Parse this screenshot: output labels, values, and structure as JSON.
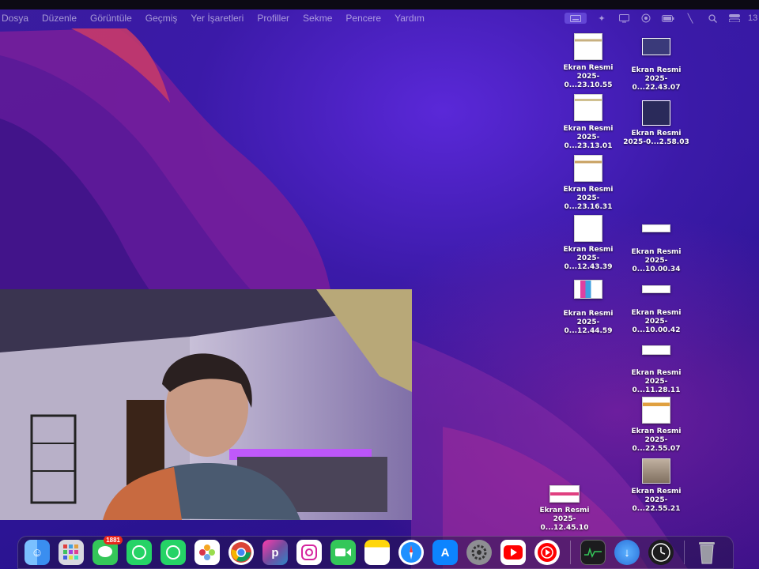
{
  "menubar": {
    "items": [
      "Dosya",
      "Düzenle",
      "Görüntüle",
      "Geçmiş",
      "Yer İşaretleri",
      "Profiller",
      "Sekme",
      "Pencere",
      "Yardım"
    ],
    "clock": "13"
  },
  "desktop": {
    "files": [
      {
        "line1": "Ekran Resmi",
        "line2": "2025-0...23.10.55"
      },
      {
        "line1": "Ekran Resmi",
        "line2": "2025-0...22.43.07"
      },
      {
        "line1": "Ekran Resmi",
        "line2": "2025-0...23.13.01"
      },
      {
        "line1": "Ekran Resmi",
        "line2": "2025-0...2.58.03"
      },
      {
        "line1": "Ekran Resmi",
        "line2": "2025-0...23.16.31"
      },
      {
        "line1": "Ekran Resmi",
        "line2": "2025-0...12.43.39"
      },
      {
        "line1": "Ekran Resmi",
        "line2": "2025-0...10.00.34"
      },
      {
        "line1": "Ekran Resmi",
        "line2": "2025-0...12.44.59"
      },
      {
        "line1": "Ekran Resmi",
        "line2": "2025-0...10.00.42"
      },
      {
        "line1": "Ekran Resmi",
        "line2": "2025-0...11.28.11"
      },
      {
        "line1": "Ekran Resmi",
        "line2": "2025-0...22.55.07"
      },
      {
        "line1": "Ekran Resmi",
        "line2": "2025-0...22.55.21"
      },
      {
        "line1": "Ekran Resmi",
        "line2": "2025-0...12.45.10"
      }
    ]
  },
  "dock": {
    "messages_badge": "1881",
    "apps": [
      "finder-icon",
      "launchpad-icon",
      "messages-icon",
      "whatsapp-icon",
      "whatsapp-business-icon",
      "photos-icon",
      "chrome-icon",
      "picsart-icon",
      "instagram-icon",
      "facetime-icon",
      "notes-icon",
      "safari-icon",
      "app-store-icon",
      "system-settings-icon",
      "youtube-icon",
      "youtube-music-icon",
      "activity-monitor-icon",
      "downloads-icon",
      "clock-icon",
      "trash-icon"
    ]
  }
}
